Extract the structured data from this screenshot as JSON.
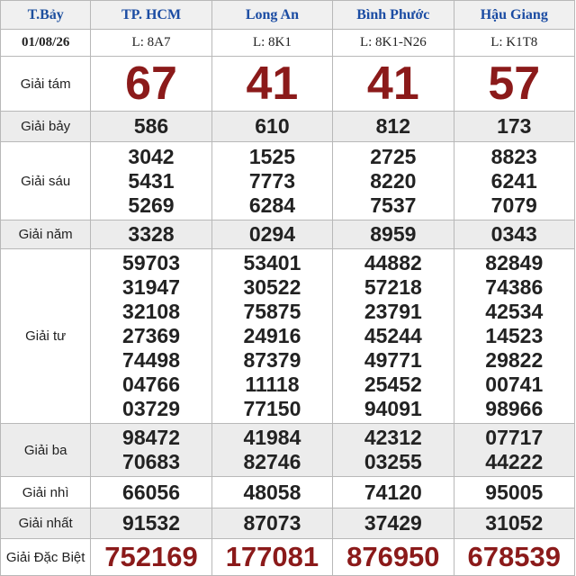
{
  "header": {
    "day": "T.Bảy",
    "date": "01/08/26",
    "provinces": [
      {
        "name": "TP. HCM",
        "code": "L: 8A7"
      },
      {
        "name": "Long An",
        "code": "L: 8K1"
      },
      {
        "name": "Bình Phước",
        "code": "L: 8K1-N26"
      },
      {
        "name": "Hậu Giang",
        "code": "L: K1T8"
      }
    ]
  },
  "prizes": {
    "g8": {
      "label": "Giải tám",
      "values": [
        "67",
        "41",
        "41",
        "57"
      ]
    },
    "g7": {
      "label": "Giải bảy",
      "values": [
        "586",
        "610",
        "812",
        "173"
      ]
    },
    "g6": {
      "label": "Giải sáu",
      "values": [
        [
          "3042",
          "5431",
          "5269"
        ],
        [
          "1525",
          "7773",
          "6284"
        ],
        [
          "2725",
          "8220",
          "7537"
        ],
        [
          "8823",
          "6241",
          "7079"
        ]
      ]
    },
    "g5": {
      "label": "Giải năm",
      "values": [
        "3328",
        "0294",
        "8959",
        "0343"
      ]
    },
    "g4": {
      "label": "Giải tư",
      "values": [
        [
          "59703",
          "31947",
          "32108",
          "27369",
          "74498",
          "04766",
          "03729"
        ],
        [
          "53401",
          "30522",
          "75875",
          "24916",
          "87379",
          "11118",
          "77150"
        ],
        [
          "44882",
          "57218",
          "23791",
          "45244",
          "49771",
          "25452",
          "94091"
        ],
        [
          "82849",
          "74386",
          "42534",
          "14523",
          "29822",
          "00741",
          "98966"
        ]
      ]
    },
    "g3": {
      "label": "Giải ba",
      "values": [
        [
          "98472",
          "70683"
        ],
        [
          "41984",
          "82746"
        ],
        [
          "42312",
          "03255"
        ],
        [
          "07717",
          "44222"
        ]
      ]
    },
    "g2": {
      "label": "Giải nhì",
      "values": [
        "66056",
        "48058",
        "74120",
        "95005"
      ]
    },
    "g1": {
      "label": "Giải nhất",
      "values": [
        "91532",
        "87073",
        "37429",
        "31052"
      ]
    },
    "db": {
      "label": "Giải Đặc Biệt",
      "values": [
        "752169",
        "177081",
        "876950",
        "678539"
      ]
    }
  },
  "colors": {
    "province_name": "#1b4ca3",
    "big_number": "#8b1a1a",
    "shaded_row": "#ececec",
    "border": "#b8b8b8"
  }
}
